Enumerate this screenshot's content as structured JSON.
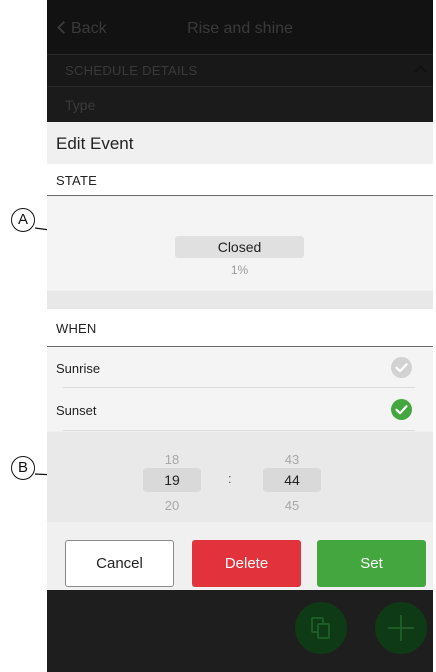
{
  "header": {
    "back_label": "Back",
    "title": "Rise and shine"
  },
  "background": {
    "section_label": "SCHEDULE DETAILS",
    "type_label": "Type"
  },
  "modal": {
    "title": "Edit Event",
    "state_section": "STATE",
    "state_button": "Closed",
    "state_percent": "1%",
    "when_section": "WHEN",
    "when_options": [
      {
        "label": "Sunrise",
        "checked": false
      },
      {
        "label": "Sunset",
        "checked": true
      }
    ],
    "time_picker": {
      "hours": {
        "prev": "18",
        "selected": "19",
        "next": "20"
      },
      "separator": ":",
      "minutes": {
        "prev": "43",
        "selected": "44",
        "next": "45"
      }
    },
    "buttons": {
      "cancel": "Cancel",
      "delete": "Delete",
      "set": "Set"
    }
  },
  "callouts": {
    "a": "A",
    "b": "B"
  },
  "colors": {
    "accent_green": "#43a63e",
    "danger_red": "#e2323c",
    "unchecked_gray": "#d2d2d2"
  },
  "icons": [
    "chevron-left-icon",
    "chevron-up-icon",
    "check-icon",
    "copy-icon",
    "plus-icon"
  ]
}
